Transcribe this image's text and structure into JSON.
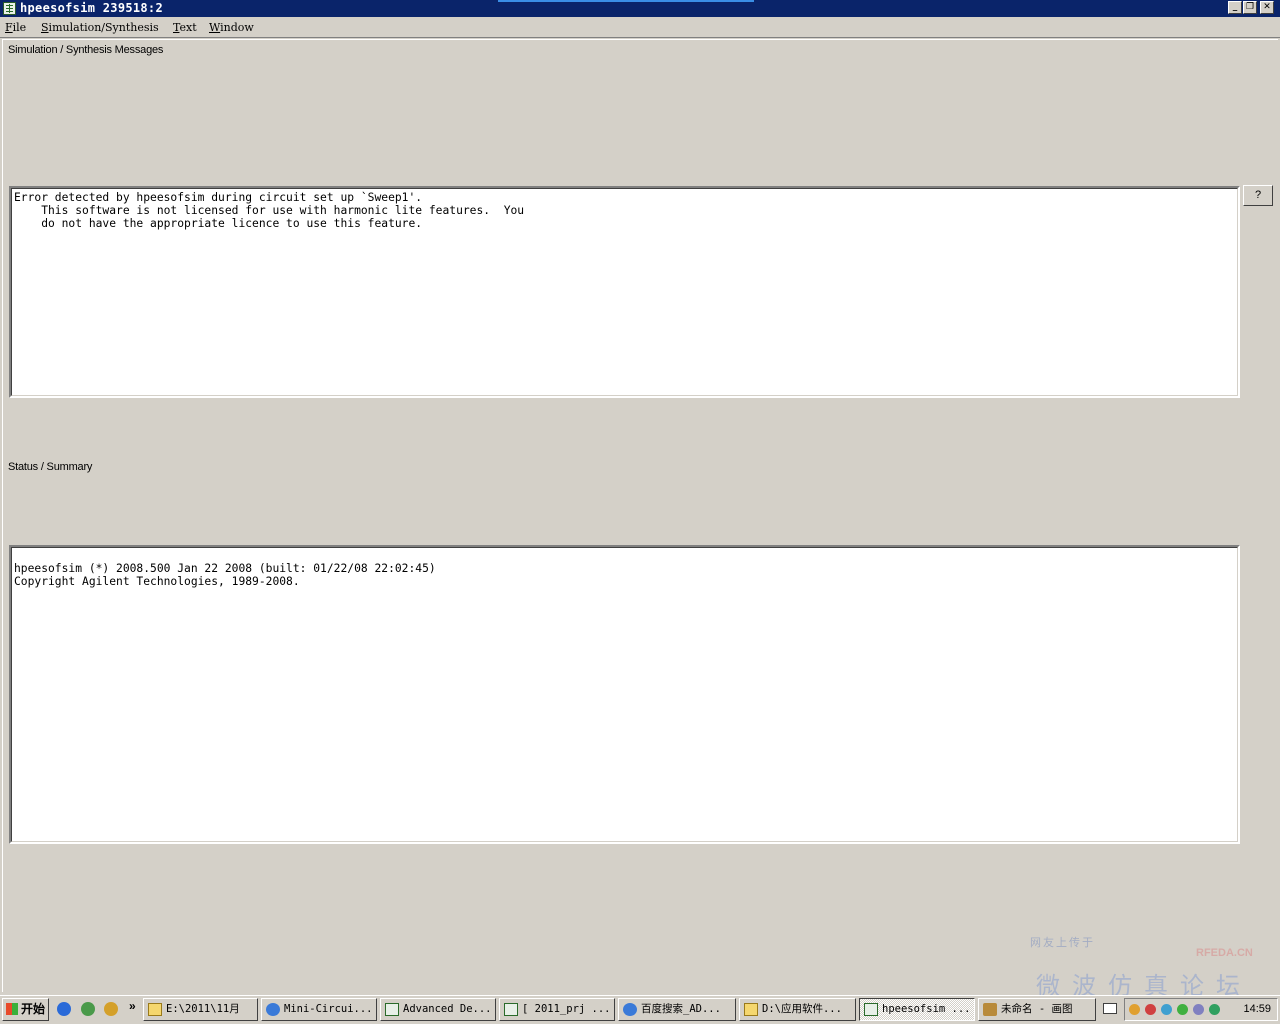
{
  "window": {
    "title": "hpeesofsim 239518:2",
    "minimize_glyph": "_",
    "restore_glyph": "❐",
    "close_glyph": "✕"
  },
  "menu": [
    "File",
    "Simulation/Synthesis",
    "Text",
    "Window"
  ],
  "messages": {
    "label": "Simulation / Synthesis Messages",
    "text": "Error detected by hpeesofsim during circuit set up `Sweep1'.\n    This software is not licensed for use with harmonic lite features.  You\n    do not have the appropriate licence to use this feature."
  },
  "help_button": "?",
  "status": {
    "label": "Status / Summary",
    "text": "hpeesofsim (*) 2008.500 Jan 22 2008 (built: 01/22/08 22:02:45)\nCopyright Agilent Technologies, 1989-2008."
  },
  "watermark": {
    "top": "网友上传于",
    "brand": "RFEDA.CN",
    "main": "微波仿真论坛"
  },
  "taskbar": {
    "start_label": "开始",
    "quicklaunch_chevron": "»",
    "tasks": [
      {
        "label": "E:\\2011\\11月",
        "icon": "folder-icon"
      },
      {
        "label": "Mini-Circui...",
        "icon": "ie-icon"
      },
      {
        "label": "Advanced De...",
        "icon": "ads-icon"
      },
      {
        "label": "[ 2011_prj ...",
        "icon": "ads-icon"
      },
      {
        "label": "百度搜索_AD...",
        "icon": "ie-icon"
      },
      {
        "label": "D:\\应用软件...",
        "icon": "folder-icon"
      },
      {
        "label": "hpeesofsim ...",
        "icon": "ads-icon",
        "active": true
      },
      {
        "label": "未命名 - 画图",
        "icon": "paint-icon"
      }
    ],
    "clock": "14:59"
  }
}
